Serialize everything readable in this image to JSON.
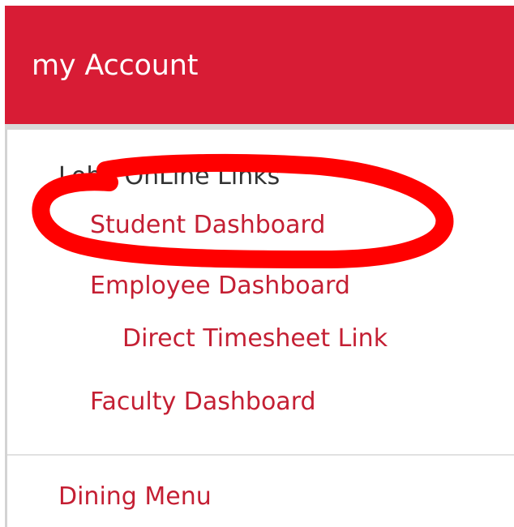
{
  "header": {
    "title": "my Account"
  },
  "section": {
    "label": "Lobo OnLine Links"
  },
  "links": {
    "student_dashboard": "Student Dashboard",
    "employee_dashboard": "Employee Dashboard",
    "direct_timesheet": "Direct Timesheet Link",
    "faculty_dashboard": "Faculty Dashboard",
    "dining_menu": "Dining Menu"
  },
  "colors": {
    "header_background": "#d81c35",
    "link_text": "#c41f33",
    "annotation_stroke": "#ff0000"
  },
  "annotation": {
    "shape": "hand-drawn-circle",
    "highlights": "student-dashboard-link"
  }
}
